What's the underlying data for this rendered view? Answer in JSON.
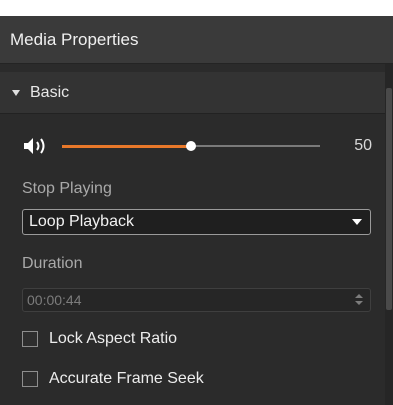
{
  "panel": {
    "title": "Media Properties"
  },
  "section": {
    "title": "Basic"
  },
  "volume": {
    "value": 50,
    "display": "50",
    "max": 100,
    "accent": "#e8782a",
    "icon": "speaker-icon"
  },
  "stop_playing": {
    "label": "Stop Playing",
    "selected": "Loop Playback"
  },
  "duration": {
    "label": "Duration",
    "value": "00:00:44"
  },
  "options": {
    "lock_aspect_ratio": {
      "label": "Lock Aspect Ratio",
      "checked": false
    },
    "accurate_frame_seek": {
      "label": "Accurate Frame Seek",
      "checked": false
    }
  }
}
